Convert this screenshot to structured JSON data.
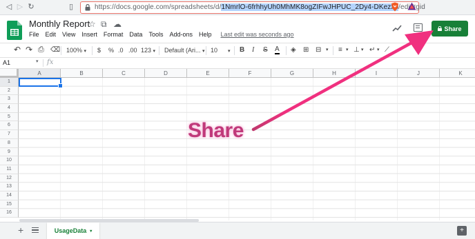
{
  "browser": {
    "back_glyph": "◁",
    "forward_glyph": "▷",
    "reload_glyph": "↻",
    "bookmark_glyph": "▯",
    "url_prefix": "https://docs.google.com/spreadsheets/d/",
    "url_highlight": "1NmrlO-6frhhyUh0MhMK8ogZIFwJHPUC_2Dy4-DKezxo",
    "url_suffix": "/edit#gid",
    "url_border_color": "#e8746a"
  },
  "header": {
    "title": "Monthly Report",
    "star_glyph": "☆",
    "folder_glyph": "⧉",
    "cloud_glyph": "☁",
    "menu_items": [
      "File",
      "Edit",
      "View",
      "Insert",
      "Format",
      "Data",
      "Tools",
      "Add-ons",
      "Help"
    ],
    "last_edit": "Last edit was seconds ago",
    "share_label": "Share",
    "share_color": "#188038"
  },
  "toolbar": {
    "undo": "↶",
    "redo": "↷",
    "print": "⎙",
    "paint": "⌫",
    "zoom": "100%",
    "currency": "$",
    "percent": "%",
    "dec_decrease": ".0",
    "dec_increase": ".00",
    "more_formats": "123",
    "font": "Default (Ari...",
    "font_size": "10",
    "bold": "B",
    "italic": "I",
    "strike": "S",
    "text_color": "A",
    "fill": "◈",
    "borders": "⊞",
    "merge": "⊟",
    "h_align": "≡",
    "v_align": "⊥",
    "wrap": "↵",
    "rotate": "⟋",
    "caret": "▾"
  },
  "formula_bar": {
    "name_box": "A1",
    "fx": "fx",
    "caret": "▾"
  },
  "grid": {
    "columns": [
      "A",
      "B",
      "C",
      "D",
      "E",
      "F",
      "G",
      "H",
      "I",
      "J",
      "K"
    ],
    "rows": [
      "1",
      "2",
      "3",
      "4",
      "5",
      "6",
      "7",
      "8",
      "9",
      "10",
      "11",
      "12",
      "13",
      "14",
      "15",
      "16"
    ],
    "active_cell": "A1"
  },
  "tabs": {
    "add": "+",
    "sheet_name": "UsageData",
    "caret": "▾",
    "explore": "+"
  },
  "annotation": {
    "text": "Share",
    "arrow_color": "#f0307f"
  }
}
